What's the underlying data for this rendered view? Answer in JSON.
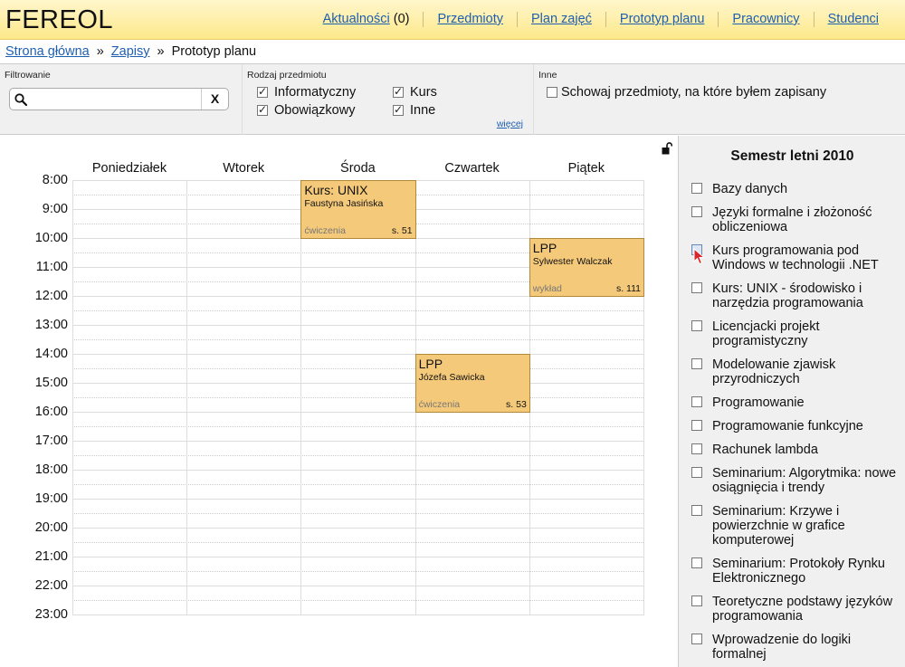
{
  "app": {
    "title": "FEREOL"
  },
  "nav": [
    {
      "label": "Aktualności",
      "suffix": " (0)"
    },
    {
      "label": "Przedmioty"
    },
    {
      "label": "Plan zajęć"
    },
    {
      "label": "Prototyp planu"
    },
    {
      "label": "Pracownicy"
    },
    {
      "label": "Studenci"
    }
  ],
  "breadcrumb": {
    "home": "Strona główna",
    "sep1": "»",
    "enrollments": "Zapisy",
    "sep2": "»",
    "current": "Prototyp planu"
  },
  "filter": {
    "title": "Filtrowanie",
    "search_value": "",
    "clear_label": "X"
  },
  "kind": {
    "title": "Rodzaj przedmiotu",
    "options": [
      {
        "label": "Informatyczny",
        "checked": true
      },
      {
        "label": "Obowiązkowy",
        "checked": true
      },
      {
        "label": "Kurs",
        "checked": true
      },
      {
        "label": "Inne",
        "checked": true
      }
    ],
    "more_label": "więcej"
  },
  "other": {
    "title": "Inne",
    "hide_enrolled_label": "Schowaj przedmioty, na które byłem zapisany",
    "hide_enrolled_checked": false
  },
  "calendar": {
    "days": [
      "Poniedziałek",
      "Wtorek",
      "Środa",
      "Czwartek",
      "Piątek"
    ],
    "hours": [
      "8:00",
      "9:00",
      "10:00",
      "11:00",
      "12:00",
      "13:00",
      "14:00",
      "15:00",
      "16:00",
      "17:00",
      "18:00",
      "19:00",
      "20:00",
      "21:00",
      "22:00",
      "23:00"
    ],
    "events": [
      {
        "title": "Kurs: UNIX",
        "teacher": "Faustyna Jasińska",
        "type": "ćwiczenia",
        "room": "s. 51",
        "day": 2,
        "start": 8,
        "end": 10
      },
      {
        "title": "LPP",
        "teacher": "Sylwester Walczak",
        "type": "wykład",
        "room": "s. 111",
        "day": 4,
        "start": 10,
        "end": 12
      },
      {
        "title": "LPP",
        "teacher": "Józefa Sawicka",
        "type": "ćwiczenia",
        "room": "s. 53",
        "day": 3,
        "start": 14,
        "end": 16
      }
    ]
  },
  "sidebar": {
    "semester_title": "Semestr letni 2010",
    "courses": [
      {
        "label": "Bazy danych",
        "checked": false,
        "lines": 1
      },
      {
        "label": "Języki formalne i złożoność obliczeniowa",
        "checked": false,
        "lines": 2
      },
      {
        "label": "Kurs programowania pod Windows w technologii .NET",
        "checked": false,
        "hovered": true,
        "lines": 2
      },
      {
        "label": "Kurs: UNIX - środowisko i narzędzia programowania",
        "checked": false,
        "lines": 2
      },
      {
        "label": "Licencjacki projekt programistyczny",
        "checked": false,
        "lines": 2
      },
      {
        "label": "Modelowanie zjawisk przyrodniczych",
        "checked": false,
        "lines": 2
      },
      {
        "label": "Programowanie",
        "checked": false,
        "lines": 1
      },
      {
        "label": "Programowanie funkcyjne",
        "checked": false,
        "lines": 1
      },
      {
        "label": "Rachunek lambda",
        "checked": false,
        "lines": 1
      },
      {
        "label": "Seminarium: Algorytmika: nowe osiągnięcia i trendy",
        "checked": false,
        "lines": 2
      },
      {
        "label": "Seminarium: Krzywe i powierzchnie w grafice komputerowej",
        "checked": false,
        "lines": 3
      },
      {
        "label": "Seminarium: Protokoły Rynku Elektronicznego",
        "checked": false,
        "lines": 2
      },
      {
        "label": "Teoretyczne podstawy języków programowania",
        "checked": false,
        "lines": 2
      },
      {
        "label": "Wprowadzenie do logiki formalnej",
        "checked": false,
        "lines": 2
      }
    ]
  }
}
